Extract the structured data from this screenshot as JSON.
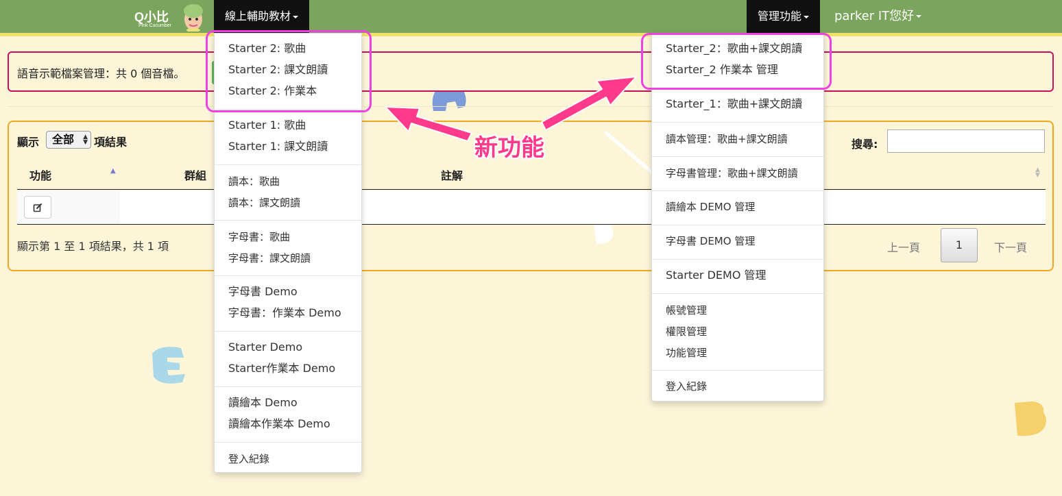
{
  "brand": {
    "logo_text": "Q小比",
    "logo_sub": "Pink Cucumber"
  },
  "nav": {
    "materials_label": "線上輔助教材",
    "admin_label": "管理功能",
    "user_label": "parker IT您好"
  },
  "audio_panel": {
    "text": "語音示範檔案管理：共 0 個音檔。"
  },
  "table": {
    "show_label": "顯示",
    "show_value": "全部",
    "show_suffix": "項結果",
    "search_label": "搜尋:",
    "search_value": "",
    "headers": [
      "功能",
      "群組",
      "註解"
    ],
    "info": "顯示第 1 至 1 項結果，共 1 項",
    "prev_label": "上一頁",
    "current_page": "1",
    "next_label": "下一頁"
  },
  "materials_menu": {
    "items": [
      "Starter 2: 歌曲",
      "Starter 2: 課文朗讀",
      "Starter 2: 作業本",
      "Starter 1: 歌曲",
      "Starter 1: 課文朗讀",
      "讀本：歌曲",
      "讀本：課文朗讀",
      "字母書：歌曲",
      "字母書：課文朗讀",
      "字母書 Demo",
      "字母書：作業本 Demo",
      "Starter Demo",
      "Starter作業本 Demo",
      "讀繪本 Demo",
      "讀繪本作業本 Demo",
      "登入紀錄"
    ]
  },
  "admin_menu": {
    "items": [
      "Starter_2：歌曲+課文朗讀",
      "Starter_2 作業本 管理",
      "Starter_1：歌曲+課文朗讀",
      "讀本管理：歌曲+課文朗讀",
      "字母書管理：歌曲+課文朗讀",
      "讀繪本 DEMO 管理",
      "字母書 DEMO 管理",
      "Starter DEMO 管理",
      "帳號管理",
      "權限管理",
      "功能管理",
      "登入紀錄"
    ]
  },
  "annotation": {
    "callout": "新功能",
    "color": "#ff3a8a",
    "box_color": "#ef40e4"
  }
}
